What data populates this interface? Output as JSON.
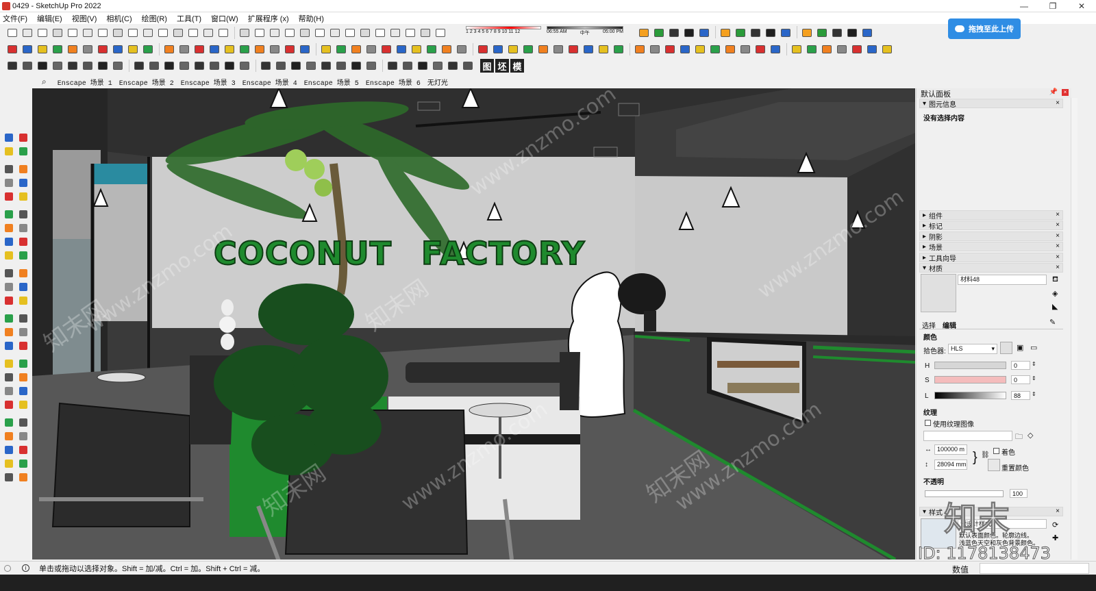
{
  "window": {
    "title": "0429 - SketchUp Pro 2022",
    "controls": [
      "—",
      "❐",
      "✕"
    ]
  },
  "menu": [
    "文件(F)",
    "编辑(E)",
    "视图(V)",
    "相机(C)",
    "绘图(R)",
    "工具(T)",
    "窗口(W)",
    "扩展程序 (x)",
    "帮助(H)"
  ],
  "toolbar": {
    "shadow_months": "1 2 3 4 5 6 7 8 9 10 11 12",
    "time_start": "06:55 AM",
    "time_mid": "中午",
    "time_end": "05:00 PM",
    "text_icons": [
      "图",
      "坯",
      "模"
    ],
    "upload_label": "拖拽至此上传"
  },
  "scenes": [
    "Enscape 场景 1",
    "Enscape 场景 2",
    "Enscape 场景 3",
    "Enscape 场景 4",
    "Enscape 场景 5",
    "Enscape 场景 6",
    "无灯光"
  ],
  "viewport": {
    "sign_text_1": "COCONUT",
    "sign_text_2": "FACTORY",
    "watermark": "www.znzmo.com",
    "watermark_cn": "知末网"
  },
  "panel": {
    "title": "默认面板",
    "entity_info": "图元信息",
    "no_selection": "没有选择内容",
    "sections": [
      "组件",
      "标记",
      "阴影",
      "场景",
      "工具向导",
      "材质"
    ],
    "material_name": "材料48",
    "tabs": [
      "选择",
      "编辑"
    ],
    "color_label": "颜色",
    "picker_label": "拾色器:",
    "picker_value": "HLS",
    "h_label": "H",
    "h_value": "0",
    "s_label": "S",
    "s_value": "0",
    "l_label": "L",
    "l_value": "88",
    "texture_label": "纹理",
    "use_texture": "使用纹理图像",
    "width_value": "100000 m",
    "height_value": "28094 mm",
    "colorize": "着色",
    "reset_color": "重置颜色",
    "opacity_label": "不透明",
    "opacity_value": "100",
    "styles_section": "样式",
    "style_name": "预设计样式",
    "style_desc_1": "默认表面颜色。轮廓边线。",
    "style_desc_2": "浅蓝色天空和灰色背景颜色。",
    "value_label": "数值"
  },
  "status": {
    "hint": "单击或拖动以选择对象。Shift = 加/减。Ctrl = 加。Shift + Ctrl = 减。"
  },
  "overlay": {
    "brand": "知末",
    "id_text": "ID: 1178138473"
  },
  "colors": {
    "accent_green": "#1f8a2e",
    "wall": "#cfcfcf",
    "ceiling": "#2e2e2e",
    "floor": "#5a5a5a"
  }
}
